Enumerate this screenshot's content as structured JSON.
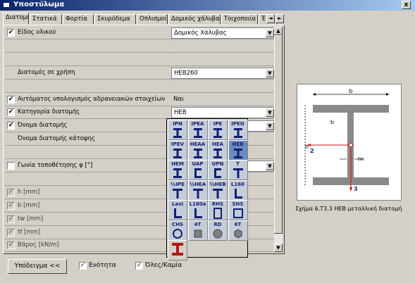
{
  "window": {
    "title": "Υποστύλωμα",
    "close_label": "x"
  },
  "tabs": [
    "Διατομή",
    "Στατικά",
    "Φορτία",
    "Σκυρόδεμα",
    "Οπλισμοί",
    "Δομικός χάλυβας",
    "Τοιχοποιία",
    "Έδα"
  ],
  "tab_scroll": {
    "left": "◄",
    "right": "►"
  },
  "rows": [
    {
      "label": "Είδος υλικού",
      "checked": true,
      "value": "Δομικός Χάλυβας",
      "has_dropdown": true,
      "white": true
    },
    {
      "label": "",
      "checked": null,
      "value": ""
    },
    {
      "label": "",
      "checked": null,
      "value": ""
    },
    {
      "label": "Διατομές σε χρήση",
      "checked": null,
      "value": "HEB260",
      "has_dropdown": true,
      "white": true
    },
    {
      "label": "",
      "checked": null,
      "value": ""
    },
    {
      "label": "Αυτόματος υπολογισμός αδρανειακών στοιχείων",
      "checked": true,
      "value": "Ναι"
    },
    {
      "label": "Κατηγορία διατομής",
      "checked": true,
      "value": "HEB",
      "has_dropdown": true,
      "white": true
    },
    {
      "label": "Όνομα διατομής",
      "checked": true,
      "value": "",
      "has_dropdown": true,
      "white": true
    },
    {
      "label": "Όνομα διατομής κάτοψης",
      "checked": null,
      "value": ""
    },
    {
      "label": "",
      "checked": null,
      "value": ""
    },
    {
      "label": "Γωνία τοποθέτησης φ [°]",
      "checked": false,
      "value": "",
      "has_dropdown": true,
      "white": true
    },
    {
      "label": "",
      "checked": null,
      "value": ""
    },
    {
      "label": "h [mm]",
      "checked": true,
      "disabled": true,
      "value": ""
    },
    {
      "label": "b [mm]",
      "checked": true,
      "disabled": true,
      "value": ""
    },
    {
      "label": "tw [mm]",
      "checked": true,
      "disabled": true,
      "value": ""
    },
    {
      "label": "tf [mm]",
      "checked": true,
      "disabled": true,
      "value": ""
    },
    {
      "label": "Βάρος [kN/m]",
      "checked": true,
      "disabled": true,
      "value": ""
    }
  ],
  "section_picker": [
    {
      "label": "IPN",
      "icon": "i-section-icon"
    },
    {
      "label": "IPEA",
      "icon": "i-section-icon"
    },
    {
      "label": "IPE",
      "icon": "i-section-icon"
    },
    {
      "label": "IPEO",
      "icon": "i-section-icon"
    },
    {
      "label": "IPEV",
      "icon": "i-section-icon"
    },
    {
      "label": "HEAA",
      "icon": "i-section-icon"
    },
    {
      "label": "HEA",
      "icon": "i-section-icon"
    },
    {
      "label": "HEB",
      "icon": "i-section-icon"
    },
    {
      "label": "HEM",
      "icon": "i-section-icon"
    },
    {
      "label": "UAP",
      "icon": "c-section-icon"
    },
    {
      "label": "UPN",
      "icon": "c-section-icon"
    },
    {
      "label": "T",
      "icon": "t-section-icon"
    },
    {
      "label": "½IPE",
      "icon": "t-section-icon"
    },
    {
      "label": "½HEA",
      "icon": "t-section-icon"
    },
    {
      "label": "½HEB",
      "icon": "t-section-icon"
    },
    {
      "label": "L160",
      "icon": "angle-section-icon"
    },
    {
      "label": "Lavi",
      "icon": "angle-section-icon"
    },
    {
      "label": "L180a",
      "icon": "angle-section-icon"
    },
    {
      "label": "RHS",
      "icon": "rhs-section-icon"
    },
    {
      "label": "SHS",
      "icon": "shs-section-icon"
    },
    {
      "label": "CHS",
      "icon": "chs-section-icon"
    },
    {
      "label": "4T",
      "icon": "square-bar-icon"
    },
    {
      "label": "RD",
      "icon": "round-bar-icon"
    },
    {
      "label": "6T",
      "icon": "hexagon-bar-icon"
    },
    {
      "label": "",
      "icon": "red-i-section-icon"
    }
  ],
  "figure": {
    "labels": {
      "b": "b",
      "h": "h",
      "tf": "tf",
      "tw": "tw",
      "axis2": "2",
      "axis3": "3"
    },
    "caption": "Σχήμα 6.Τ3.3 HEB μεταλλική διατομή"
  },
  "footer": {
    "example_button": "Υπόδειγμα <<",
    "unit_checkbox": {
      "label": "Ενότητα",
      "checked": true
    },
    "all_none_checkbox": {
      "label": "Όλες/Καμία",
      "checked": true
    }
  },
  "colors": {
    "title_start": "#0a246a",
    "title_end": "#a6caf0",
    "picker_icon": "#102070",
    "selected_section": "#b01818"
  }
}
